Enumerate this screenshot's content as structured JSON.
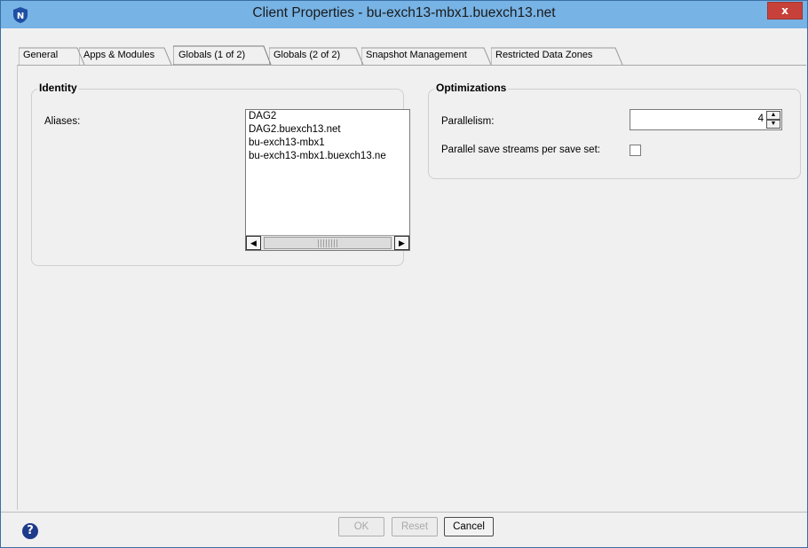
{
  "window": {
    "title": "Client Properties - bu-exch13-mbx1.buexch13.net",
    "close_label": "x",
    "app_icon": "networker-shield-icon"
  },
  "tabs": [
    {
      "label": "General",
      "active": false
    },
    {
      "label": "Apps & Modules",
      "active": false
    },
    {
      "label": "Globals (1 of 2)",
      "active": true
    },
    {
      "label": "Globals (2 of 2)",
      "active": false
    },
    {
      "label": "Snapshot Management",
      "active": false
    },
    {
      "label": "Restricted Data Zones",
      "active": false
    }
  ],
  "identity": {
    "group_title": "Identity",
    "aliases_label": "Aliases:",
    "aliases": [
      "DAG2",
      "DAG2.buexch13.net",
      "bu-exch13-mbx1",
      "bu-exch13-mbx1.buexch13.ne"
    ]
  },
  "optimizations": {
    "group_title": "Optimizations",
    "parallelism_label": "Parallelism:",
    "parallelism_value": "4",
    "parallel_save_label": "Parallel save streams per save set:",
    "parallel_save_checked": false
  },
  "footer": {
    "help_icon": "?",
    "ok_label": "OK",
    "reset_label": "Reset",
    "cancel_label": "Cancel"
  },
  "colors": {
    "titlebar": "#77b3e5",
    "close": "#c7403a",
    "help": "#1e3a8a"
  }
}
